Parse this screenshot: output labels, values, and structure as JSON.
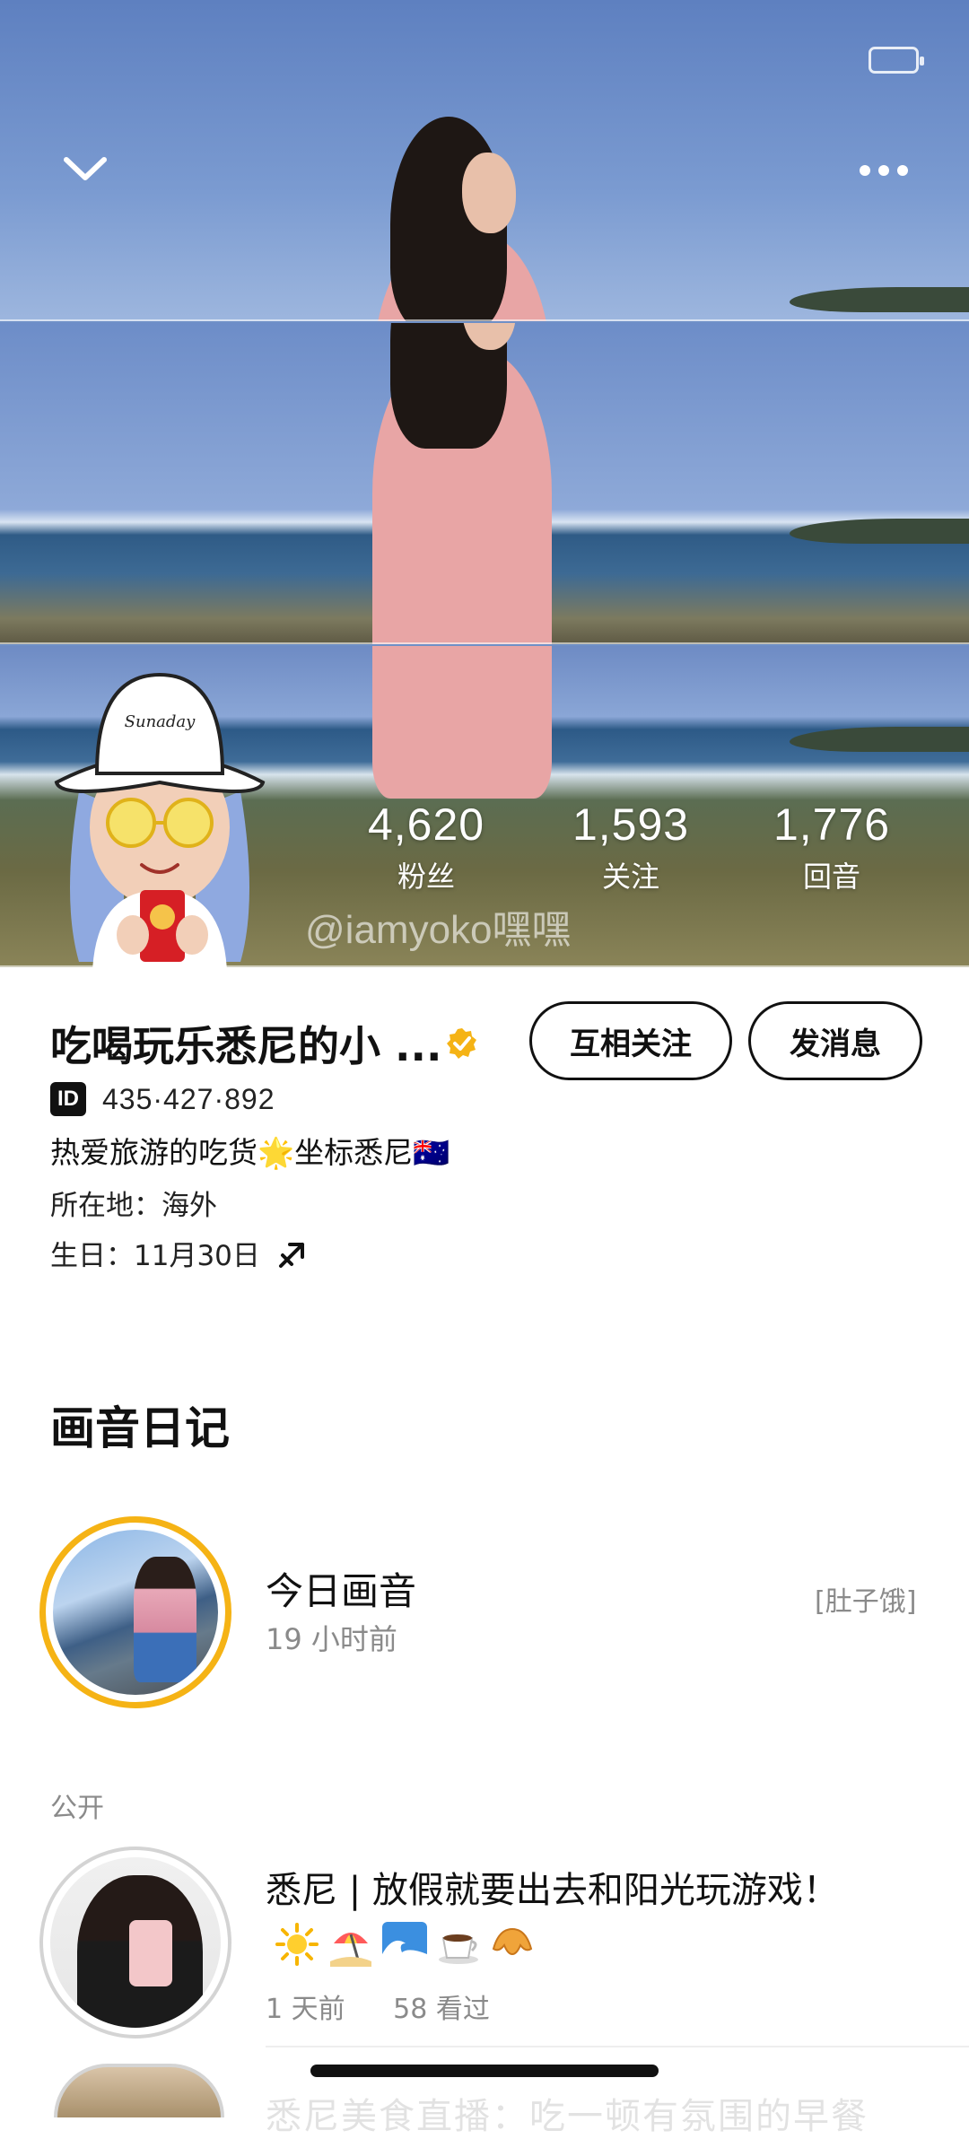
{
  "status_bar": {
    "time": "",
    "signal": ""
  },
  "nav": {
    "back_icon": "chevron-down-icon",
    "more_icon": "more-dots-icon"
  },
  "stats": [
    {
      "value": "4,620",
      "label": "粉丝"
    },
    {
      "value": "1,593",
      "label": "关注"
    },
    {
      "value": "1,776",
      "label": "回音"
    }
  ],
  "watermark": "@iamyoko嘿嘿",
  "profile": {
    "name": "吃喝玩乐悉尼的小 ...",
    "verified_icon": "verified-badge-icon",
    "verified_color": "#f5b315",
    "follow_label": "互相关注",
    "message_label": "发消息",
    "id_badge": "ID",
    "id_value": "435·427·892",
    "bio": "热爱旅游的吃货🌟坐标悉尼🇦🇺",
    "location": "所在地：海外",
    "birthday": "生日：11月30日",
    "zodiac_icon": "sagittarius-icon"
  },
  "diary": {
    "section_title": "画音日记",
    "today": {
      "title": "今日画音",
      "time": "19 小时前",
      "tag": "[肚子饿]"
    },
    "public_label": "公开",
    "public_item": {
      "title": "悉尼 | 放假就要出去和阳光玩游戏！",
      "emojis": [
        "sun-icon",
        "beach-umbrella-icon",
        "wave-icon",
        "coffee-icon",
        "croissant-icon"
      ],
      "time": "1 天前",
      "views": "58 看过"
    },
    "next_item_text": "悉尼美食直播：吃一顿有氛围的早餐"
  },
  "colors": {
    "accent": "#f5b315",
    "text": "#111111",
    "secondary": "#8a8a8a"
  }
}
